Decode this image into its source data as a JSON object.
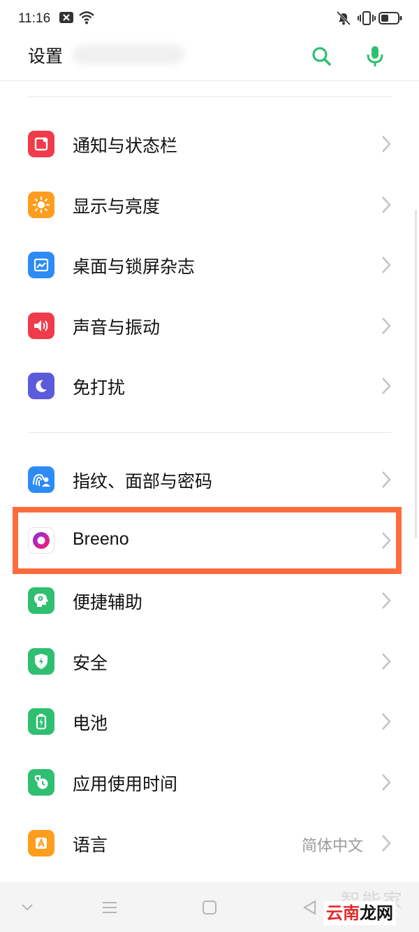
{
  "status_bar": {
    "time": "11:16",
    "icons": [
      "notification-x-icon",
      "wifi-icon",
      "mute-icon",
      "vibrate-icon",
      "battery-icon"
    ]
  },
  "header": {
    "title": "设置",
    "search_icon": "search-icon",
    "voice_icon": "microphone-icon",
    "accent_color": "#2fbf71"
  },
  "sections": [
    {
      "items": [
        {
          "label": "通知与状态栏",
          "icon": "notification-icon",
          "color": "#ef3b4a"
        },
        {
          "label": "显示与亮度",
          "icon": "brightness-icon",
          "color": "#ff9d1f"
        },
        {
          "label": "桌面与锁屏杂志",
          "icon": "wallpaper-icon",
          "color": "#2d8bf5"
        },
        {
          "label": "声音与振动",
          "icon": "speaker-icon",
          "color": "#ef3b4a"
        },
        {
          "label": "免打扰",
          "icon": "moon-icon",
          "color": "#5b5bdc"
        }
      ]
    },
    {
      "items": [
        {
          "label": "指纹、面部与密码",
          "icon": "fingerprint-face-icon",
          "color": "#2d8bf5"
        },
        {
          "label": "Breeno",
          "icon": "breeno-icon",
          "color": "#d81b8f"
        },
        {
          "label": "便捷辅助",
          "icon": "assist-icon",
          "color": "#2fbf71"
        },
        {
          "label": "安全",
          "icon": "shield-icon",
          "color": "#2fbf71"
        },
        {
          "label": "电池",
          "icon": "battery-icon",
          "color": "#2fbf71"
        },
        {
          "label": "应用使用时间",
          "icon": "app-time-icon",
          "color": "#2fbf71"
        },
        {
          "label": "语言",
          "icon": "language-icon",
          "color": "#ff9d1f",
          "value": "简体中文"
        }
      ]
    }
  ],
  "highlight_color": "#ff6b3d",
  "nav_bar": {
    "icons": [
      "chevron-down-icon",
      "menu-icon",
      "home-icon",
      "back-icon"
    ]
  },
  "watermark": {
    "text_red": "云南",
    "text_dark": "龙网",
    "text_faint": "智能家"
  }
}
